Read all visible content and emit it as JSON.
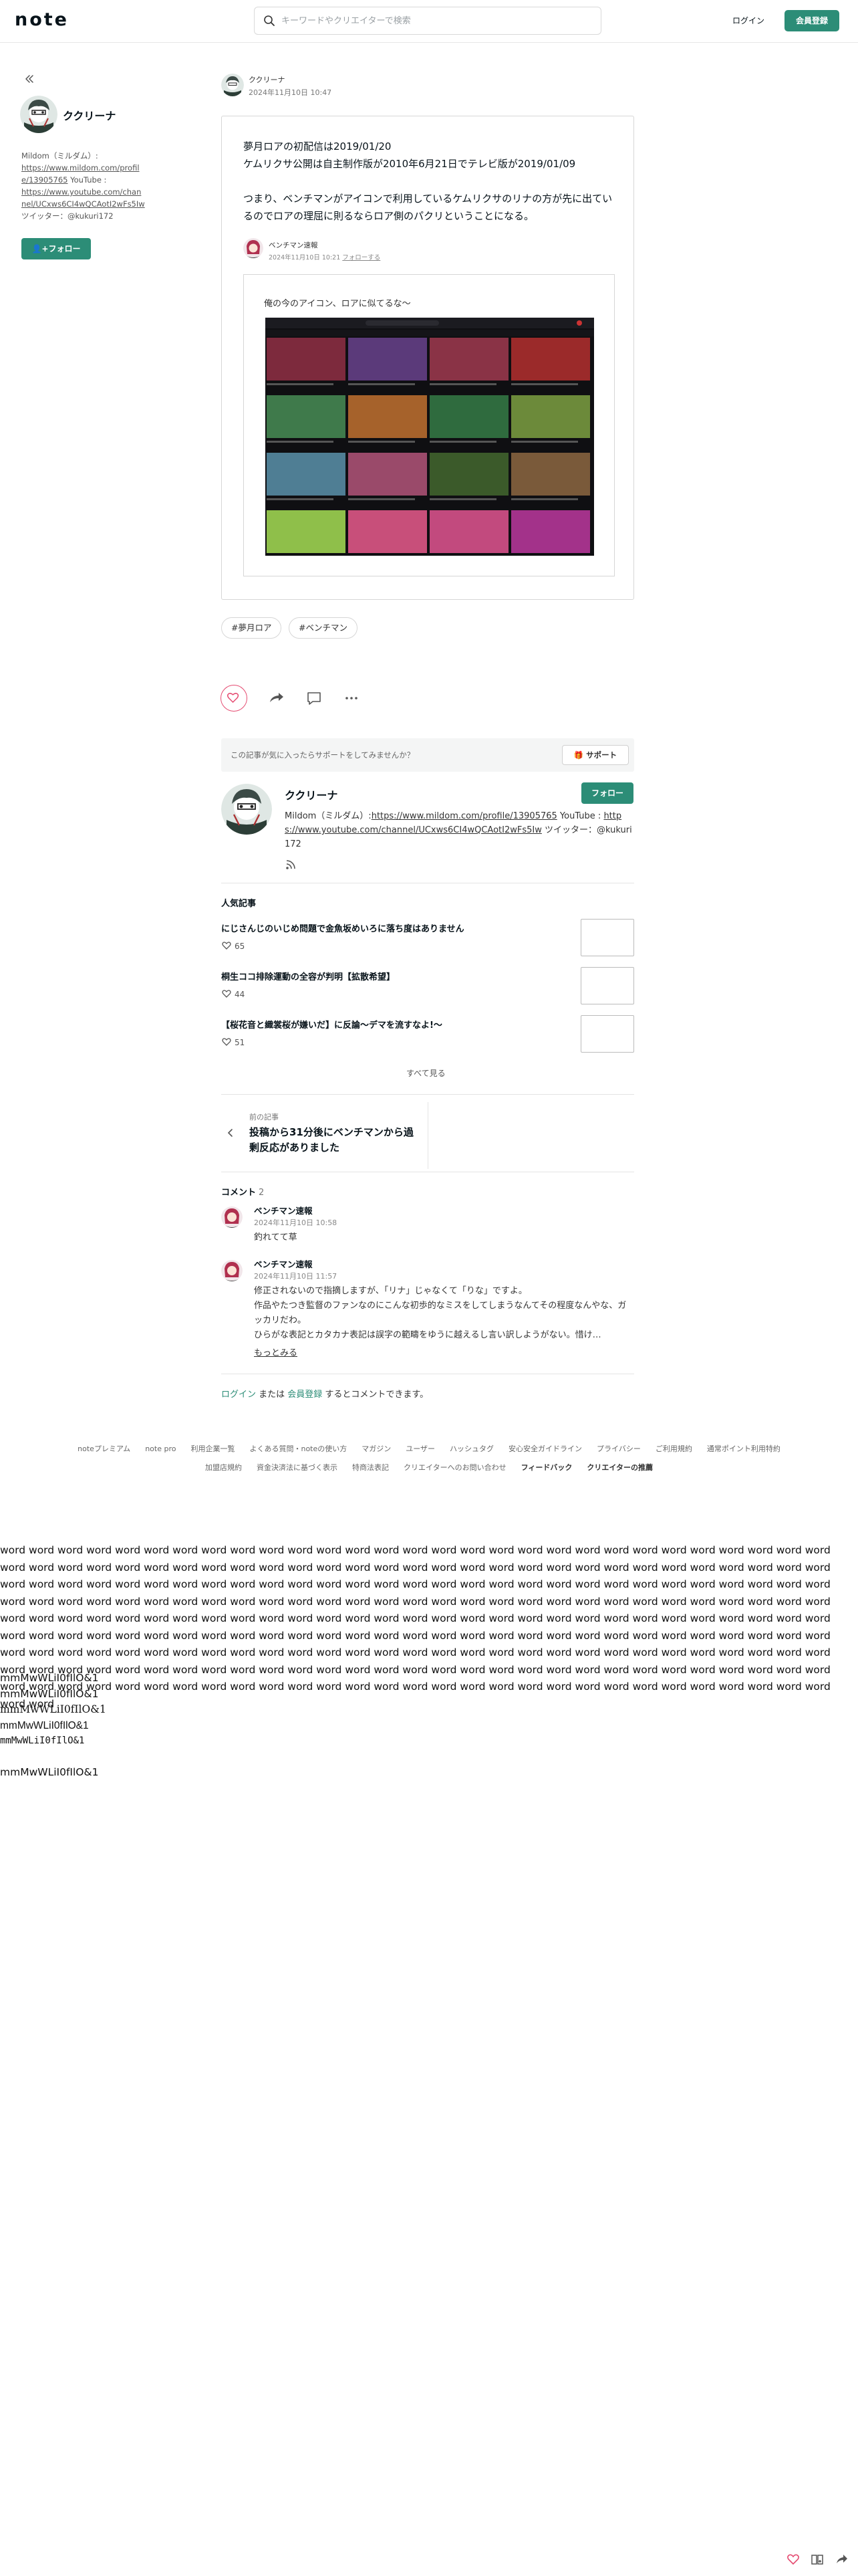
{
  "header": {
    "logo": "note",
    "search_placeholder": "キーワードやクリエイターで検索",
    "login": "ログイン",
    "signup": "会員登録"
  },
  "sidebar": {
    "creator_name": "ククリーナ",
    "bio_prefix": "Mildom（ミルダム）:",
    "mildom_url": "https://www.mildom.com/profile/13905765",
    "youtube_label": " YouTube :",
    "youtube_url": "https://www.youtube.com/channel/UCxws6CI4wQCAotI2wFs5Iw",
    "twitter": " ツイッター：@kukuri172",
    "follow": "フォロー"
  },
  "article": {
    "author": "ククリーナ",
    "date": "2024年11月10日 10:47",
    "embed_lines": [
      "夢月ロアの初配信は2019/01/20",
      "ケムリクサ公開は自主制作版が2010年6月21日でテレビ版が2019/01/09",
      "つまり、ベンチマンがアイコンで利用しているケムリクサのリナの方が先に出ているのでロアの理屈に則るならロア側のパクリということになる。"
    ],
    "inner_author": "ベンチマン速報",
    "inner_date": "2024年11月10日 10:21",
    "inner_follow": "フォローする",
    "inner_text": "俺の今のアイコン、ロアに似てるな〜",
    "tags": [
      "#夢月ロア",
      "#ベンチマン"
    ]
  },
  "support": {
    "prompt": "この記事が気に入ったらサポートをしてみませんか？",
    "button": "サポート"
  },
  "profile": {
    "name": "ククリーナ",
    "follow": "フォロー",
    "bio_prefix": "Mildom（ミルダム）:",
    "mildom_url": "https://www.mildom.com/profile/13905765",
    "youtube_label": " YouTube :",
    "youtube_url": "https://www.youtube.com/channel/UCxws6CI4wQCAotI2wFs5Iw",
    "twitter": " ツイッター：@kukuri172"
  },
  "popular": {
    "title": "人気記事",
    "items": [
      {
        "title": "にじさんじのいじめ問題で金魚坂めいろに落ち度はありません",
        "likes": "65"
      },
      {
        "title": "桐生ココ排除運動の全容が判明【拡散希望】",
        "likes": "44"
      },
      {
        "title": "【桜花音と織裳桜が嫌いだ】に反論〜デマを流すなよ!〜",
        "likes": "51"
      }
    ],
    "see_all": "すべて見る"
  },
  "prev": {
    "label": "前の記事",
    "title": "投稿から31分後にベンチマンから過剰反応がありました"
  },
  "comments": {
    "label": "コメント",
    "count": "2",
    "items": [
      {
        "name": "ベンチマン速報",
        "date": "2024年11月10日 10:58",
        "lines": [
          "釣れてて草"
        ]
      },
      {
        "name": "ベンチマン速報",
        "date": "2024年11月10日 11:57",
        "lines": [
          "修正されないので指摘しますが、「リナ」じゃなくて「りな」ですよ。",
          "作品やたつき監督のファンなのにこんな初歩的なミスをしてしまうなんてその程度なんやな、ガッカリだわ。",
          "ひらがな表記とカタカナ表記は誤字の範疇をゆうに越えるし言い訳しようがない。惜け…"
        ]
      }
    ],
    "more": "もっとみる",
    "login_link": "ログイン",
    "or": " または ",
    "signup_link": "会員登録",
    "suffix": " するとコメントできます。"
  },
  "footer": {
    "row1": [
      "noteプレミアム",
      "note pro",
      "利用企業一覧",
      "よくある質問・noteの使い方",
      "マガジン",
      "ユーザー",
      "ハッシュタグ",
      "安心安全ガイドライン",
      "プライバシー",
      "ご利用規約",
      "通常ポイント利用特約"
    ],
    "row2": [
      "加盟店規約",
      "資金決済法に基づく表示",
      "特商法表記",
      "クリエイターへのお問い合わせ",
      "フィードバック",
      "クリエイターの推薦"
    ]
  },
  "filler_text": "word word word word word word word word word word word word word word word word word word word word word word word word word word word word word word word word word word word word word word word word word word word word word word word word word word word word word word word word word word word word word word word word word word word word word word word word word word word word word word word word word word word word word word word word word word word word word word word word word word word word word word word word word word word word word word word word word word word word word word word word word word word word word word word word word word word word word word word word word word word word word word word word word word word word word word word word word word word word word word word word word word word word word word word word word word word word word word word word word word word word word word word word word word word word word word word word word word word word word word word word word word word word word word word word word word word word word word word word word word word word word word word word word word word word word word word word word word word word word word word word word word word word word word word word word word word word word word word word word word word word word word word",
  "mono_lines": [
    "mmMwWLiI0fIlO&1",
    "mmMwWLiI0fIlO&1",
    "mmMwWLiI0fIlO&1",
    "mmMwWLiI0fIlO&1",
    "mmMwWLiI0fIlO&1",
    "",
    "mmMwWLiI0fIlO&1"
  ]
}
